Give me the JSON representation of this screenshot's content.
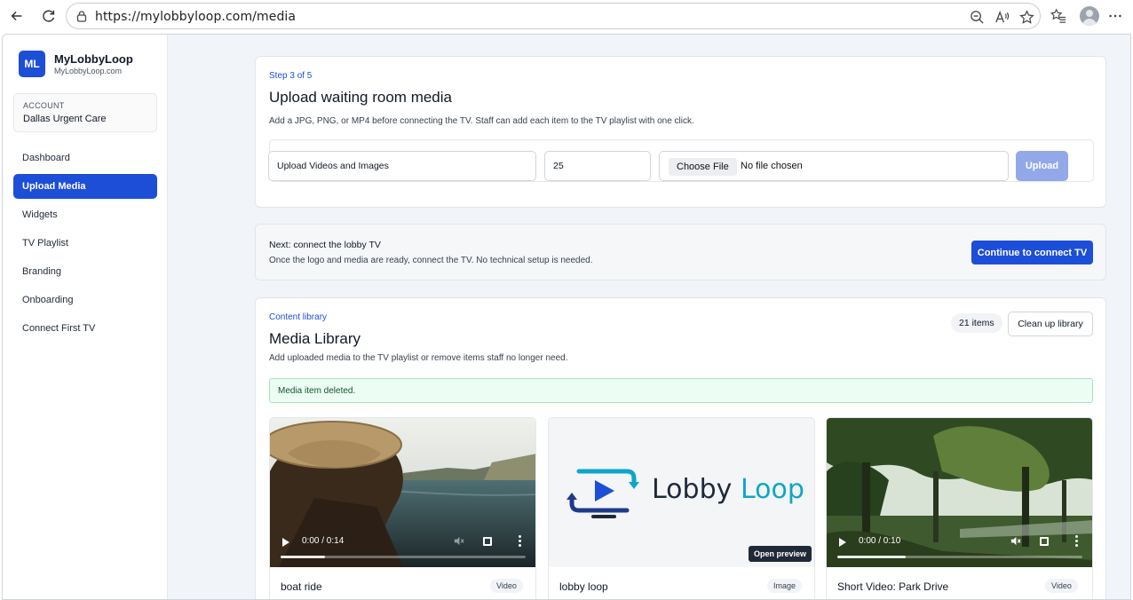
{
  "browser": {
    "url": "https://mylobbyloop.com/media"
  },
  "sidebar": {
    "logo_initials": "ML",
    "brand_name": "MyLobbyLoop",
    "brand_domain": "MyLobbyLoop.com",
    "account_label": "ACCOUNT",
    "account_name": "Dallas Urgent Care",
    "items": [
      {
        "label": "Dashboard",
        "active": false
      },
      {
        "label": "Upload Media",
        "active": true
      },
      {
        "label": "Widgets",
        "active": false
      },
      {
        "label": "TV Playlist",
        "active": false
      },
      {
        "label": "Branding",
        "active": false
      },
      {
        "label": "Onboarding",
        "active": false
      },
      {
        "label": "Connect First TV",
        "active": false
      }
    ]
  },
  "upload": {
    "step": "Step 3 of 5",
    "title": "Upload waiting room media",
    "description": "Add a JPG, PNG, or MP4 before connecting the TV. Staff can add each item to the TV playlist with one click.",
    "title_field_value": "Upload Videos and Images",
    "duration_value": "25",
    "choose_file_label": "Choose File",
    "no_file_text": "No file chosen",
    "upload_button": "Upload"
  },
  "next": {
    "title": "Next: connect the lobby TV",
    "description": "Once the logo and media are ready, connect the TV. No technical setup is needed.",
    "button": "Continue to connect TV"
  },
  "library": {
    "eyebrow": "Content library",
    "title": "Media Library",
    "description": "Add uploaded media to the TV playlist or remove items staff no longer need.",
    "count": "21 items",
    "cleanup_button": "Clean up library",
    "alert": "Media item deleted.",
    "items": [
      {
        "name": "boat ride",
        "type": "Video",
        "time": "0:00 / 0:14",
        "progress": 0.18
      },
      {
        "name": "lobby loop",
        "type": "Image",
        "preview_button": "Open preview",
        "logo_text_1": "Lobby",
        "logo_text_2": "Loop"
      },
      {
        "name": "Short Video: Park Drive",
        "type": "Video",
        "time": "0:00 / 0:10",
        "progress": 0.28
      }
    ]
  },
  "colors": {
    "primary": "#1d4ed8",
    "upload_disabled": "#93a8e8",
    "alert_bg": "#ecfdf3",
    "page_bg": "#f1f4f8"
  }
}
